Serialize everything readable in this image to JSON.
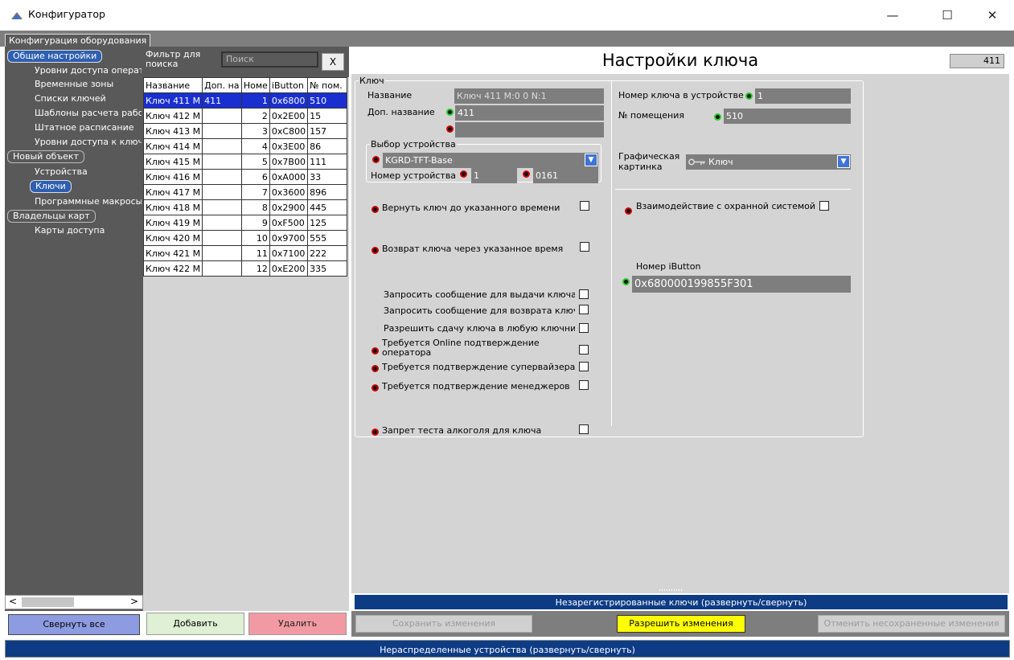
{
  "window": {
    "title": "Конфигуратор",
    "minimize": "—",
    "maximize": "☐",
    "close": "✕"
  },
  "config_tab": "Конфигурация оборудования",
  "nav": {
    "groups": [
      {
        "label": "Общие настройки",
        "items": [
          "Уровни доступа операторов",
          "Временные зоны",
          "Списки ключей",
          "Шаблоны расчета работы",
          "Штатное расписание",
          "Уровни доступа к ключам"
        ]
      },
      {
        "label": "Новый объект",
        "items": [
          "Устройства",
          "Ключи",
          "Программные макросы"
        ]
      },
      {
        "label": "Владельцы карт",
        "items": [
          "Карты доступа"
        ]
      }
    ],
    "selected": "Ключи",
    "collapse_all": "Свернуть все",
    "scroll_left": "<",
    "scroll_right": ">"
  },
  "filter": {
    "label": "Фильтр для поиска",
    "placeholder": "Поиск",
    "clear": "X"
  },
  "grid": {
    "columns": [
      "Название",
      "Доп. на",
      "Номе",
      "iButton",
      "№ пом."
    ],
    "rows": [
      [
        "Ключ 411 М",
        "411",
        "1",
        "0x6800",
        "510"
      ],
      [
        "Ключ 412 М",
        "",
        "2",
        "0x2E00",
        "15"
      ],
      [
        "Ключ 413 М",
        "",
        "3",
        "0xC800",
        "157"
      ],
      [
        "Ключ 414 М",
        "",
        "4",
        "0x3E00",
        "86"
      ],
      [
        "Ключ 415 М",
        "",
        "5",
        "0x7B00",
        "111"
      ],
      [
        "Ключ 416 М",
        "",
        "6",
        "0xA000",
        "33"
      ],
      [
        "Ключ 417 М",
        "",
        "7",
        "0x3600",
        "896"
      ],
      [
        "Ключ 418 М",
        "",
        "8",
        "0x2900",
        "445"
      ],
      [
        "Ключ 419 М",
        "",
        "9",
        "0xF500",
        "125"
      ],
      [
        "Ключ 420 М",
        "",
        "10",
        "0x9700",
        "555"
      ],
      [
        "Ключ 421 М",
        "",
        "11",
        "0x7100",
        "222"
      ],
      [
        "Ключ 422 М",
        "",
        "12",
        "0xE200",
        "335"
      ]
    ],
    "selected_row": 0,
    "add": "Добавить",
    "delete": "Удалить"
  },
  "panel": {
    "title": "Настройки ключа",
    "id": "411",
    "key_group": "Ключ",
    "name_label": "Название",
    "name_value": "Ключ 411 М:0 0 N:1",
    "extra_label": "Доп. название",
    "extra_value": "411",
    "extra_value2": "",
    "device_group": "Выбор устройства",
    "device_value": "KGRD-TFT-Base",
    "device_num_label": "Номер устройства",
    "device_num": "1",
    "device_code": "0161",
    "key_num_label": "Номер ключа в устройстве",
    "key_num": "1",
    "room_label": "№ помещения",
    "room": "510",
    "picture_label": "Графическая картинка",
    "picture_value": "Ключ",
    "options": [
      {
        "label": "Вернуть ключ до указанного времени",
        "dot": true
      },
      {
        "label": "Возврат ключа через указанное время",
        "dot": true
      },
      {
        "label": "Запросить сообщение для выдачи ключа",
        "dot": false
      },
      {
        "label": "Запросить сообщение для возврата ключа",
        "dot": false
      },
      {
        "label": "Разрешить сдачу ключа в любую ключницу",
        "dot": false
      },
      {
        "label": "Требуется Online подтверждение оператора",
        "dot": true
      },
      {
        "label": "Требуется подтверждение супервайзера",
        "dot": true
      },
      {
        "label": "Требуется подтверждение менеджеров",
        "dot": true
      },
      {
        "label": "Запрет теста алкоголя для ключа",
        "dot": true
      }
    ],
    "security_label": "Взаимодействие с охранной системой",
    "ibutton_label": "Номер iButton",
    "ibutton_value": "0x680000199855F301"
  },
  "unregistered": "Незарегистрированные ключи (развернуть/свернуть)",
  "actions": {
    "save": "Сохранить изменения",
    "allow": "Разрешить изменения",
    "cancel": "Отменить несохраненные изменения"
  },
  "undistributed": "Нераспределенные устройства (развернуть/свернуть)",
  "colors": {
    "accent_blue": "#0d3c85",
    "selection": "#1a2fd0",
    "allow_yellow": "#ffff00",
    "delete_red": "#f29aa3",
    "add_green": "#dff0d4"
  }
}
